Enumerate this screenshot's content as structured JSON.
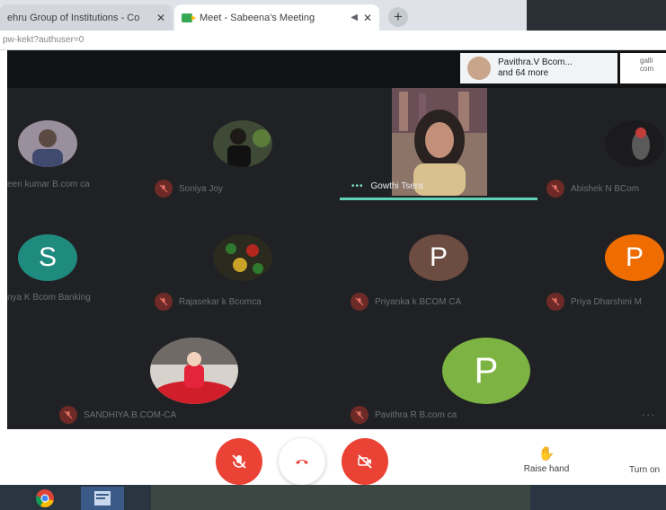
{
  "browser": {
    "tabs": [
      {
        "title": "ehru Group of Institutions - Co",
        "close": "✕"
      },
      {
        "title": "Meet - Sabeena's Meeting",
        "close": "✕"
      }
    ],
    "new_tab": "+",
    "url": "pw-kekt?authuser=0"
  },
  "meet": {
    "attendee_pill": {
      "line1": "Pavithra.V Bcom...",
      "line2": "and 64 more"
    },
    "side_panel_text": {
      "line1": "galli",
      "line2": "com"
    },
    "participants": [
      {
        "name": "een kumar B.com ca",
        "avatar_kind": "photo",
        "avatar_color": "#9a8f9c"
      },
      {
        "name": "Soniya Joy",
        "avatar_kind": "photo",
        "avatar_color": "#3e4a36"
      },
      {
        "name": "Abishek N BCom",
        "avatar_kind": "photo",
        "avatar_color": "#1b1b1d"
      },
      {
        "name": "nya K Bcom Banking",
        "avatar_kind": "letter",
        "letter": "S",
        "avatar_color": "#1f8a7e"
      },
      {
        "name": "Rajasekar k Bcomca",
        "avatar_kind": "photo",
        "avatar_color": "#2a2a1e"
      },
      {
        "name": "Priyanka k BCOM CA",
        "avatar_kind": "letter",
        "letter": "P",
        "avatar_color": "#6d4c41"
      },
      {
        "name": "Priya Dharshini M",
        "avatar_kind": "letter",
        "letter": "P",
        "avatar_color": "#ef6c00"
      },
      {
        "name": "SANDHIYA.B.COM-CA",
        "avatar_kind": "photo",
        "avatar_color": "#d7d2cc"
      },
      {
        "name": "Pavithra R B.com ca",
        "avatar_kind": "letter",
        "letter": "P",
        "avatar_color": "#7cb342"
      }
    ],
    "active_speaker": {
      "name": "Gowthi Tsera"
    },
    "more": "..."
  },
  "controls": {
    "mic_state": "muted",
    "camera_state": "off",
    "raise_hand_label": "Raise hand",
    "turn_on_label": "Turn on",
    "end_call_color": "#ea4335"
  },
  "colors": {
    "meet_bg": "#202124",
    "muted_red": "#ea4335",
    "speaking_accent": "#5fd3b8"
  }
}
